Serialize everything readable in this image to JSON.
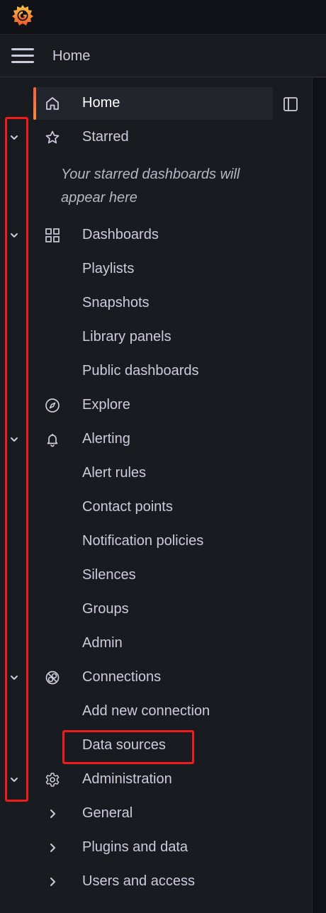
{
  "header": {
    "title": "Home"
  },
  "starred_empty_message": "Your starred dashboards will appear here",
  "nav": {
    "home": "Home",
    "starred": "Starred",
    "dashboards": "Dashboards",
    "playlists": "Playlists",
    "snapshots": "Snapshots",
    "library_panels": "Library panels",
    "public_dashboards": "Public dashboards",
    "explore": "Explore",
    "alerting": "Alerting",
    "alert_rules": "Alert rules",
    "contact_points": "Contact points",
    "notification_policies": "Notification policies",
    "silences": "Silences",
    "groups": "Groups",
    "admin": "Admin",
    "connections": "Connections",
    "add_new_connection": "Add new connection",
    "data_sources": "Data sources",
    "administration": "Administration",
    "general": "General",
    "plugins_and_data": "Plugins and data",
    "users_and_access": "Users and access"
  },
  "icons": {
    "logo": "grafana-logo",
    "menu": "hamburger-icon",
    "dock": "dock-panel-icon",
    "home": "home-icon",
    "starred": "star-icon",
    "dashboards": "apps-grid-icon",
    "explore": "compass-icon",
    "alerting": "bell-icon",
    "connections": "connections-icon",
    "administration": "gear-icon",
    "expand": "chevron-down-icon",
    "collapsed": "chevron-right-icon"
  },
  "colors": {
    "background": "#181b1f",
    "text": "#ccccdc",
    "active_bar_start": "#f55f3e",
    "active_bar_end": "#ff8833",
    "annotation": "#f01b1b"
  }
}
